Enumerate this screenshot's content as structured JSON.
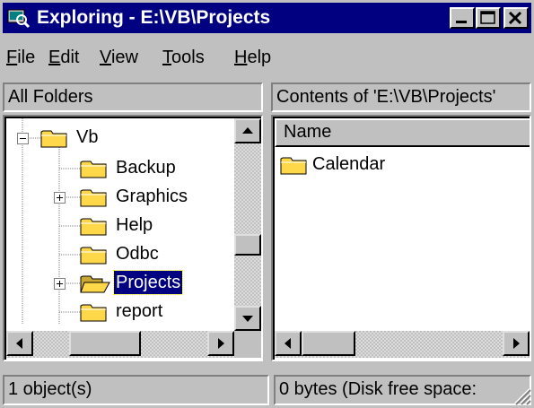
{
  "window": {
    "title": "Exploring - E:\\VB\\Projects",
    "app_icon": "explorer-icon",
    "controls": [
      "minimize-icon",
      "maximize-icon",
      "close-icon"
    ]
  },
  "menu": [
    {
      "label": "File",
      "accel": "F",
      "rest": "ile"
    },
    {
      "label": "Edit",
      "accel": "E",
      "rest": "dit"
    },
    {
      "label": "View",
      "accel": "V",
      "rest": "iew"
    },
    {
      "label": "Tools",
      "accel": "T",
      "rest": "ools"
    },
    {
      "label": "Help",
      "accel": "H",
      "rest": "elp"
    }
  ],
  "left_pane": {
    "header": "All Folders",
    "tree": [
      {
        "label": "Vb",
        "expander": "-",
        "selected": false
      },
      {
        "label": "Backup",
        "expander": "",
        "selected": false
      },
      {
        "label": "Graphics",
        "expander": "+",
        "selected": false
      },
      {
        "label": "Help",
        "expander": "",
        "selected": false
      },
      {
        "label": "Odbc",
        "expander": "",
        "selected": false
      },
      {
        "label": "Projects",
        "expander": "+",
        "selected": true
      },
      {
        "label": "report",
        "expander": "",
        "selected": false
      }
    ]
  },
  "right_pane": {
    "header": "Contents of 'E:\\VB\\Projects'",
    "columns": [
      "Name"
    ],
    "items": [
      {
        "name": "Calendar",
        "icon": "folder-icon"
      }
    ]
  },
  "status": {
    "left": "1 object(s)",
    "right": "0 bytes (Disk free space:"
  },
  "colors": {
    "titlebar": "#000080",
    "face": "#c0c0c0",
    "selection": "#000080",
    "folder": "#ffd84a"
  }
}
